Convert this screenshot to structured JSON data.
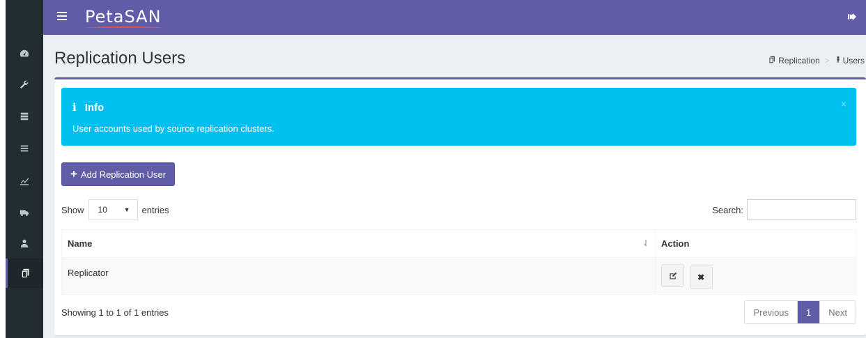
{
  "app": {
    "logo_text": "PetaSAN"
  },
  "sidebar": {
    "items": [
      {
        "icon": "dashboard-icon"
      },
      {
        "icon": "wrench-icon"
      },
      {
        "icon": "server-icon"
      },
      {
        "icon": "list-icon"
      },
      {
        "icon": "chart-icon"
      },
      {
        "icon": "truck-icon"
      },
      {
        "icon": "user-icon"
      },
      {
        "icon": "copy-icon",
        "active": true
      }
    ]
  },
  "header": {
    "title": "Replication Users"
  },
  "breadcrumb": {
    "item1": "Replication",
    "item2": "Users"
  },
  "alert": {
    "title": "Info",
    "icon_glyph": "i",
    "text": "User accounts used by source replication clusters.",
    "close_glyph": "×"
  },
  "toolbar": {
    "add_label": "Add Replication User"
  },
  "table_controls": {
    "show_label": "Show",
    "entries_label": "entries",
    "page_size": "10",
    "search_label": "Search:"
  },
  "table": {
    "headers": [
      "Name",
      "Action"
    ],
    "rows": [
      {
        "name": "Replicator"
      }
    ]
  },
  "footer": {
    "info": "Showing 1 to 1 of 1 entries",
    "prev_label": "Previous",
    "current_page": "1",
    "next_label": "Next"
  },
  "colors": {
    "brand": "#605ca8",
    "info": "#00c0ef",
    "sidebar": "#222d32"
  }
}
